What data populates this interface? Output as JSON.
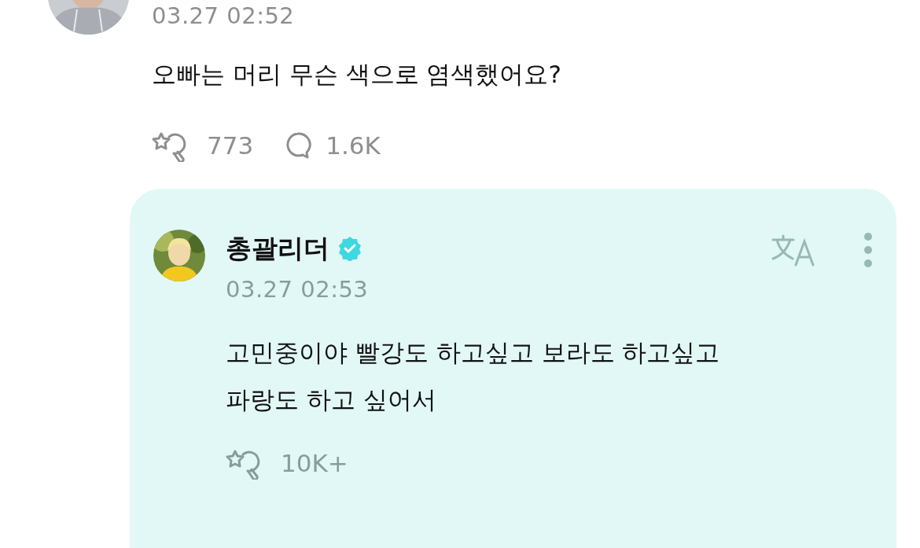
{
  "post": {
    "timestamp": "03.27 02:52",
    "text": "오빠는 머리 무슨 색으로 염색했어요?",
    "likes": "773",
    "comments": "1.6K"
  },
  "reply": {
    "author": "총괄리더",
    "verified": true,
    "timestamp": "03.27 02:53",
    "text": "고민중이야 빨강도 하고싶고 보라도 하고싶고\n파랑도 하고 싶어서",
    "likes": "10K+"
  }
}
